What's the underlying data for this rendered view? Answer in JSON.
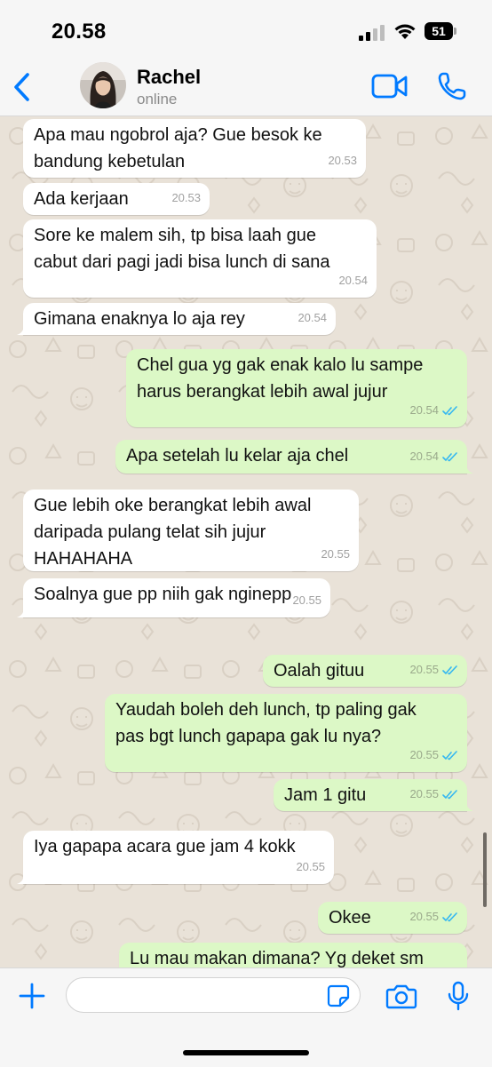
{
  "status_bar": {
    "time": "20.58",
    "battery": "51"
  },
  "header": {
    "name": "Rachel",
    "status": "online"
  },
  "messages": [
    {
      "dir": "in",
      "text": "Apa mau ngobrol aja? Gue besok ke\nbandung kebetulan",
      "time": "20.53"
    },
    {
      "dir": "in",
      "text": "Ada kerjaan",
      "time": "20.53"
    },
    {
      "dir": "in",
      "text": "Sore ke malem sih, tp bisa laah gue\ncabut dari pagi jadi bisa lunch di sana",
      "time": "20.54"
    },
    {
      "dir": "in",
      "text": "Gimana enaknya lo aja rey",
      "time": "20.54"
    },
    {
      "dir": "out",
      "text": "Chel gua yg gak enak kalo lu sampe\nharus berangkat lebih awal jujur",
      "time": "20.54"
    },
    {
      "dir": "out",
      "text": "Apa setelah lu kelar aja chel",
      "time": "20.54"
    },
    {
      "dir": "in",
      "text": "Gue lebih oke berangkat lebih awal\ndaripada pulang telat sih jujur\nHAHAHAHA",
      "time": "20.55"
    },
    {
      "dir": "in",
      "text": "Soalnya gue pp niih gak nginepp",
      "time": "20.55"
    },
    {
      "dir": "out",
      "text": "Oalah gituu",
      "time": "20.55"
    },
    {
      "dir": "out",
      "text": "Yaudah boleh deh lunch, tp paling gak\npas bgt lunch gapapa gak lu nya?",
      "time": "20.55"
    },
    {
      "dir": "out",
      "text": "Jam 1 gitu",
      "time": "20.55"
    },
    {
      "dir": "in",
      "text": "Iya gapapa acara gue jam 4 kokk",
      "time": "20.55"
    },
    {
      "dir": "out",
      "text": "Okee",
      "time": "20.55"
    },
    {
      "dir": "out",
      "text": "Lu mau makan dimana? Yg deket sm",
      "time": ""
    }
  ],
  "input": {
    "placeholder": ""
  },
  "colors": {
    "accent": "#007aff",
    "outgoing_bubble": "#dcf8c6",
    "incoming_bubble": "#ffffff",
    "read_ticks": "#34b7f1"
  }
}
